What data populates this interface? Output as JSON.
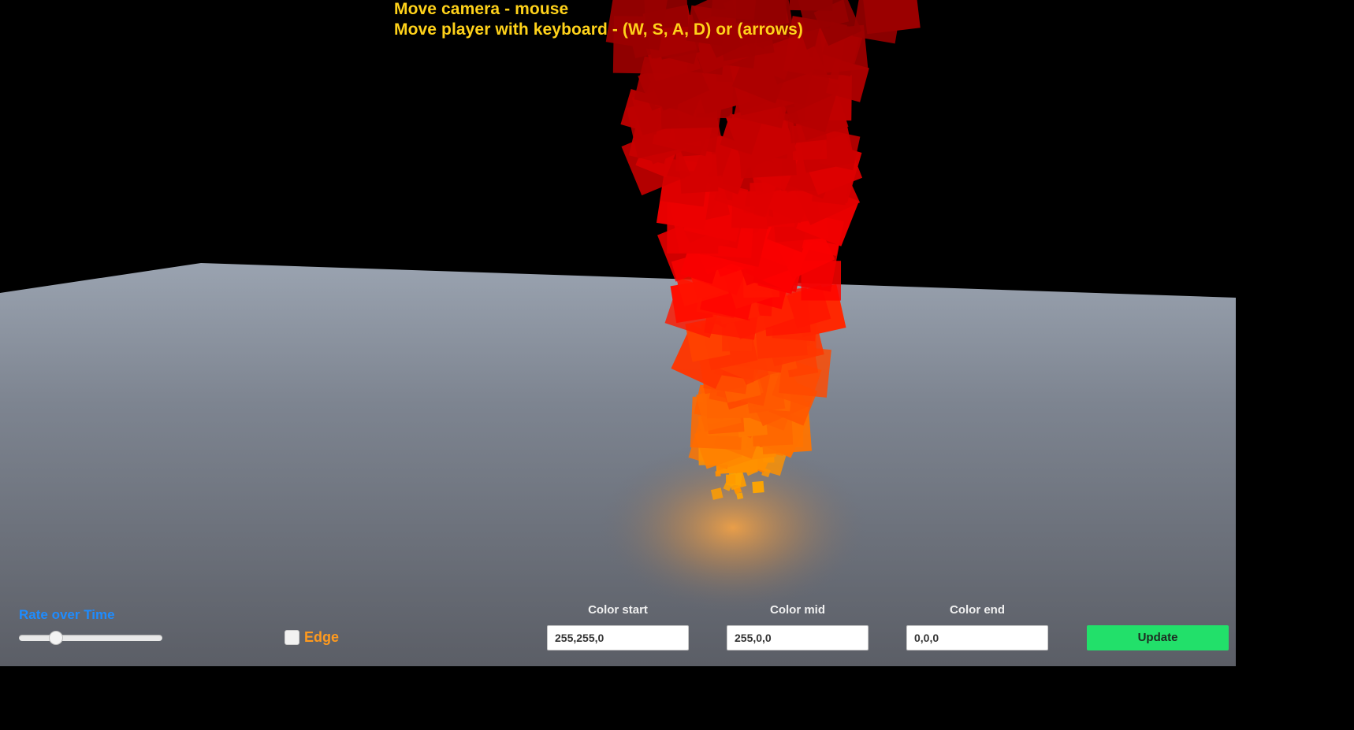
{
  "hints": {
    "camera": "Move camera - mouse",
    "player": "Move player with keyboard - (W, S, A, D) or (arrows)"
  },
  "controls": {
    "rate_label": "Rate over Time",
    "rate_value": 0.23,
    "edge": {
      "label": "Edge",
      "checked": false
    },
    "color_start": {
      "label": "Color start",
      "value": "255,255,0"
    },
    "color_mid": {
      "label": "Color mid",
      "value": "255,0,0"
    },
    "color_end": {
      "label": "Color end",
      "value": "0,0,0"
    },
    "update_label": "Update"
  },
  "colors": {
    "hint_text": "#ffd21a",
    "rate_label": "#1e8cff",
    "edge_label": "#ff9a1e",
    "update_button": "#22e06a",
    "sky": "#000000",
    "ground": "#6e7480"
  }
}
